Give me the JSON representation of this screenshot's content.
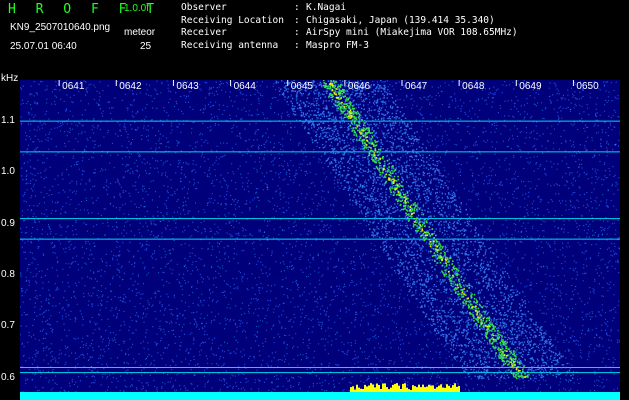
{
  "app": {
    "brand": "H R O F F T",
    "version": "1.0.0f"
  },
  "file": {
    "name": "KN9_2507010640.png",
    "datetime": "25.07.01 06:40"
  },
  "meteor": {
    "label": "meteor",
    "value": "25"
  },
  "info": [
    {
      "key": "Observer",
      "value": "K.Nagai"
    },
    {
      "key": "Receiving Location",
      "value": "Chigasaki, Japan (139.414 35.340)"
    },
    {
      "key": "Receiver",
      "value": "AirSpy mini (Miakejima VOR 108.65MHz)"
    },
    {
      "key": "Receiving antenna",
      "value": "Maspro FM-3"
    }
  ],
  "colors": {
    "brand": "#20ff20",
    "plot_bg": "#00007a",
    "signal": "#00ffff",
    "echo": "#40ff40",
    "peak": "#ffff00"
  },
  "chart_data": {
    "type": "heatmap",
    "ylabel": "kHz",
    "x_ticks": [
      "0641",
      "0642",
      "0643",
      "0644",
      "0645",
      "0646",
      "0647",
      "0648",
      "0649",
      "0650"
    ],
    "y_ticks": [
      "1.1",
      "1.0",
      "0.9",
      "0.8",
      "0.7",
      "0.6"
    ],
    "ylim": [
      0.58,
      1.18
    ],
    "xlim": [
      "0640",
      "0650"
    ],
    "carrier_lines_khz": [
      1.1,
      1.04,
      0.91,
      0.87,
      0.62,
      0.61
    ],
    "meteor_trace": [
      {
        "time": "0645.7",
        "khz": 1.18
      },
      {
        "time": "0646.4",
        "khz": 1.06
      },
      {
        "time": "0647.3",
        "khz": 0.9
      },
      {
        "time": "0648.3",
        "khz": 0.73
      },
      {
        "time": "0649.1",
        "khz": 0.6
      }
    ]
  }
}
